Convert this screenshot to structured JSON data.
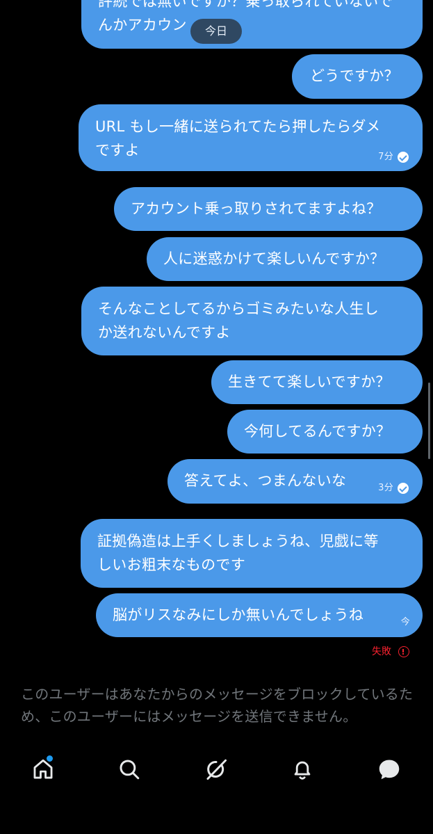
{
  "chat": {
    "date_divider": "今日",
    "messages": [
      {
        "lines": [
          "評続では無いですか？乗っ取られていないで",
          "んかアカウン"
        ],
        "time": "",
        "read": false
      },
      {
        "lines": [
          "どうですか？"
        ],
        "time": "",
        "read": false
      },
      {
        "lines": [
          "URL もし一緒に送られてたら押したらダメ",
          "ですよ"
        ],
        "time": "7分",
        "read": true
      },
      {
        "lines": [
          "アカウント乗っ取りされてますよね？"
        ],
        "time": "",
        "read": false
      },
      {
        "lines": [
          "人に迷惑かけて楽しいんですか？"
        ],
        "time": "",
        "read": false
      },
      {
        "lines": [
          "そんなことしてるからゴミみたいな人生し",
          "か送れないんですよ"
        ],
        "time": "",
        "read": false
      },
      {
        "lines": [
          "生きてて楽しいですか？"
        ],
        "time": "",
        "read": false
      },
      {
        "lines": [
          "今何してるんですか？"
        ],
        "time": "",
        "read": false
      },
      {
        "lines": [
          "答えてよ、つまんないな"
        ],
        "time": "3分",
        "read": true
      },
      {
        "lines": [
          "証拠偽造は上手くしましょうね、児戯に等",
          "しいお粗末なものです"
        ],
        "time": "",
        "read": false
      },
      {
        "lines": [
          "脳がリスなみにしか無いんでしょうね"
        ],
        "time": "今",
        "read": false
      }
    ],
    "failed_label": "失敗"
  },
  "blocked_notice": "このユーザーはあなたからのメッセージをブロックしているため、このユーザーにはメッセージを送信できません。",
  "tabbar": {
    "items": [
      {
        "icon": "home-icon",
        "has_notification": true
      },
      {
        "icon": "search-icon",
        "has_notification": false
      },
      {
        "icon": "grok-icon",
        "has_notification": false
      },
      {
        "icon": "bell-icon",
        "has_notification": false
      },
      {
        "icon": "messages-icon",
        "has_notification": false
      }
    ]
  },
  "colors": {
    "bubble": "#4b99e9",
    "background": "#000000",
    "failed": "#f4212e",
    "muted_text": "#71767b",
    "accent": "#1d9bf0"
  }
}
